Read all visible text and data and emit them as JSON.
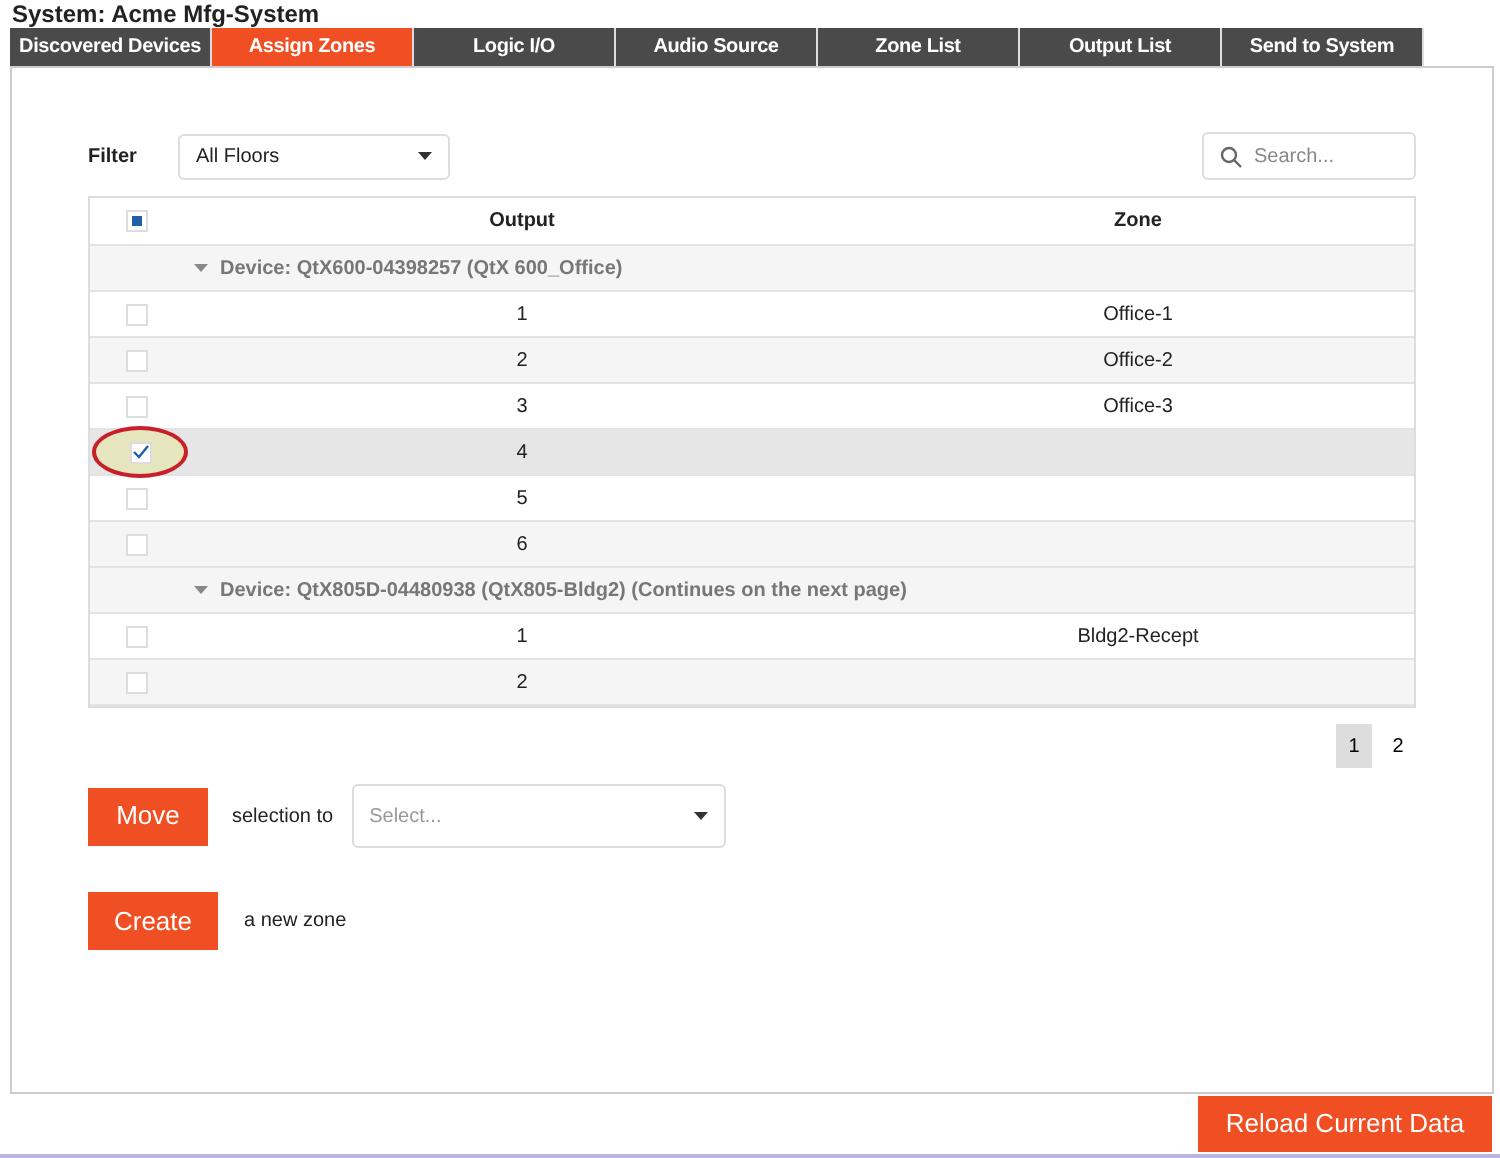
{
  "system_title": "System: Acme Mfg-System",
  "tabs": [
    {
      "label": "Discovered Devices",
      "selected": false
    },
    {
      "label": "Assign Zones",
      "selected": true
    },
    {
      "label": "Logic I/O",
      "selected": false
    },
    {
      "label": "Audio Source",
      "selected": false
    },
    {
      "label": "Zone List",
      "selected": false
    },
    {
      "label": "Output List",
      "selected": false
    },
    {
      "label": "Send to System",
      "selected": false
    }
  ],
  "filter": {
    "label": "Filter",
    "value": "All Floors"
  },
  "search": {
    "placeholder": "Search..."
  },
  "table": {
    "select_all": {
      "indeterminate": true
    },
    "columns": [
      "Output",
      "Zone"
    ],
    "groups": [
      {
        "label": "Device: QtX600-04398257 (QtX 600_Office)",
        "expanded": true,
        "rows": [
          {
            "output": "1",
            "zone": "Office-1",
            "checked": false,
            "selected": false,
            "circled": false
          },
          {
            "output": "2",
            "zone": "Office-2",
            "checked": false,
            "selected": false,
            "circled": false
          },
          {
            "output": "3",
            "zone": "Office-3",
            "checked": false,
            "selected": false,
            "circled": false
          },
          {
            "output": "4",
            "checked": true,
            "selected": true,
            "circled": true
          },
          {
            "output": "5",
            "checked": false,
            "selected": false,
            "circled": false
          },
          {
            "output": "6",
            "checked": false,
            "selected": false,
            "circled": false
          }
        ]
      },
      {
        "label": "Device: QtX805D-04480938 (QtX805-Bldg2) (Continues on the next page)",
        "expanded": true,
        "rows": [
          {
            "output": "1",
            "zone": "Bldg2-Recept",
            "checked": false,
            "selected": false,
            "circled": false
          },
          {
            "output": "2",
            "checked": false,
            "selected": false,
            "circled": false
          }
        ]
      }
    ]
  },
  "pages": [
    {
      "label": "1",
      "selected": true
    },
    {
      "label": "2",
      "selected": false
    }
  ],
  "move": {
    "button": "Move",
    "text": "selection to",
    "select_placeholder": "Select..."
  },
  "create": {
    "button": "Create",
    "text": "a new zone"
  },
  "reload_button": "Reload Current Data"
}
